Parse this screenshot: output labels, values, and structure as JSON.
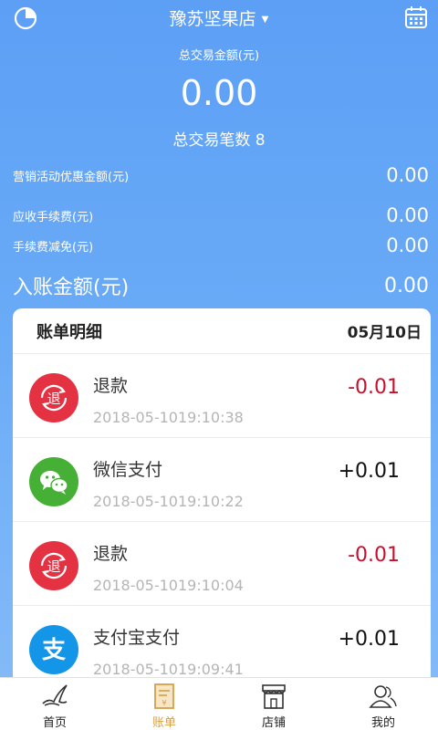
{
  "header": {
    "store_name": "豫苏坚果店",
    "pie_icon": "pie-chart-icon",
    "calendar_icon": "calendar-icon"
  },
  "summary": {
    "total_amount_label": "总交易金额(元)",
    "total_amount": "0.00",
    "count_label": "总交易笔数",
    "count": "8"
  },
  "stats": [
    {
      "label": "营销活动优惠金额(元)",
      "value": "0.00"
    },
    {
      "label": "应收手续费(元)",
      "value": "0.00"
    },
    {
      "label": "手续费减免(元)",
      "value": "0.00"
    },
    {
      "label": "入账金额(元)",
      "value": "0.00"
    }
  ],
  "bill": {
    "title": "账单明细",
    "date": "05月10日",
    "items": [
      {
        "name": "退款",
        "time": "2018-05-1019:10:38",
        "amount": "-0.01",
        "icon": "refund-icon",
        "color": "#e53242"
      },
      {
        "name": "微信支付",
        "time": "2018-05-1019:10:22",
        "amount": "+0.01",
        "icon": "wechat-icon",
        "color": "#45b035"
      },
      {
        "name": "退款",
        "time": "2018-05-1019:10:04",
        "amount": "-0.01",
        "icon": "refund-icon",
        "color": "#e53242"
      },
      {
        "name": "支付宝支付",
        "time": "2018-05-1019:09:41",
        "amount": "+0.01",
        "icon": "alipay-icon",
        "color": "#1396e8"
      }
    ]
  },
  "tabs": [
    {
      "label": "首页",
      "icon": "home-bird-icon"
    },
    {
      "label": "账单",
      "icon": "receipt-icon",
      "active": true
    },
    {
      "label": "店铺",
      "icon": "store-icon"
    },
    {
      "label": "我的",
      "icon": "user-icon"
    }
  ],
  "colors": {
    "accent": "#d4a04a",
    "negative": "#c8102e",
    "gradient_top": "#5c9ff5",
    "gradient_bottom": "#86bcf8"
  }
}
